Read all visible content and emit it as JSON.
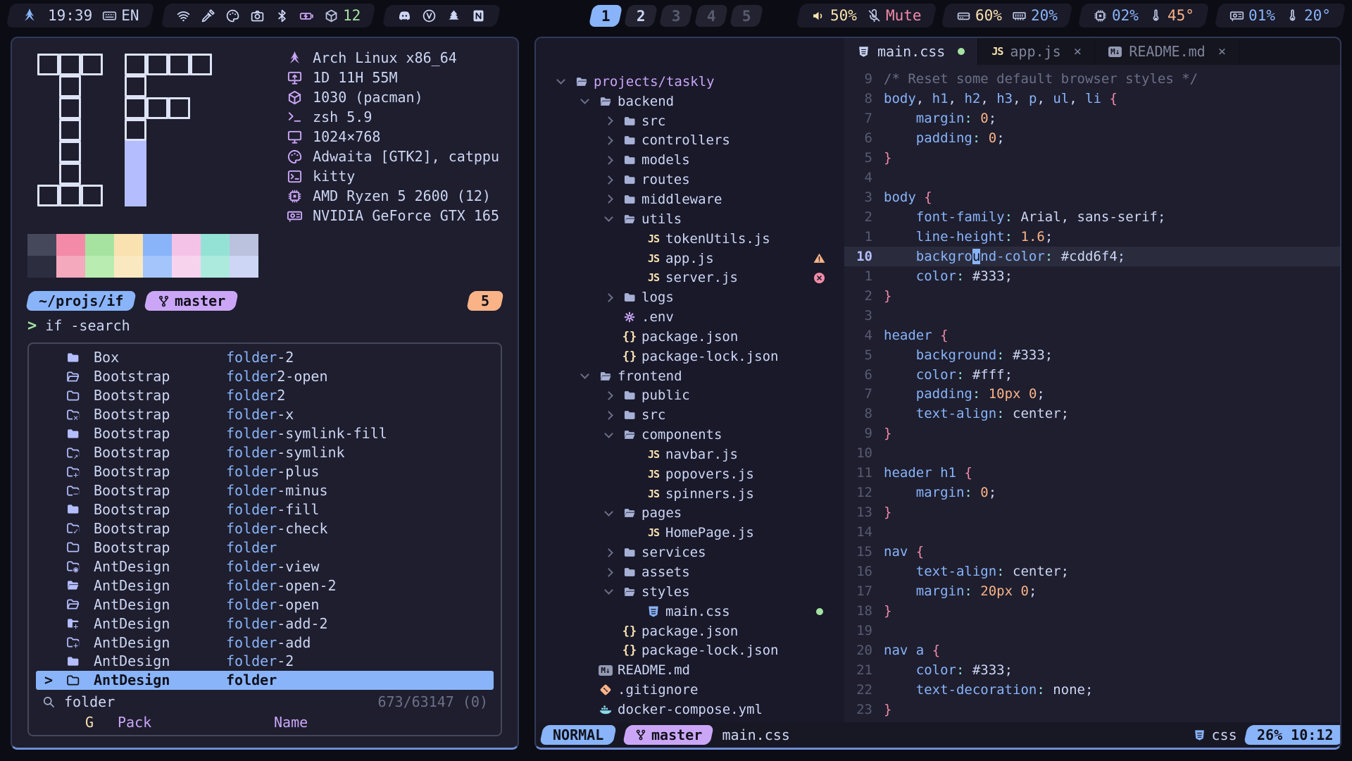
{
  "topbar": {
    "time": "19:39",
    "layout": "EN",
    "packages": "12",
    "workspaces": [
      {
        "label": "1",
        "state": "active"
      },
      {
        "label": "2",
        "state": "occupied"
      },
      {
        "label": "3",
        "state": "empty"
      },
      {
        "label": "4",
        "state": "empty"
      },
      {
        "label": "5",
        "state": "empty"
      }
    ],
    "volume": "50%",
    "mute": "Mute",
    "disk": "60%",
    "memory": "20%",
    "cpu": "02%",
    "cpu_temp": "45°",
    "gpu": "01%",
    "gpu_temp": "20°"
  },
  "terminal": {
    "fetch": {
      "logo_rows": [
        "ooo.oooo",
        ".o..o...",
        ".o..ooo.",
        ".o..o...",
        ".o..f...",
        ".o..f...",
        "ooo.f..."
      ],
      "lines": [
        {
          "icon": "arch",
          "text": "Arch Linux x86_64"
        },
        {
          "icon": "uptime",
          "text": "1D 11H 55M"
        },
        {
          "icon": "cube",
          "text": "1030 (pacman)"
        },
        {
          "icon": "shell",
          "text": "zsh 5.9"
        },
        {
          "icon": "display",
          "text": "1024×768"
        },
        {
          "icon": "palette",
          "text": "Adwaita [GTK2], catppu"
        },
        {
          "icon": "terminal",
          "text": "kitty"
        },
        {
          "icon": "cpu-chip",
          "text": "AMD Ryzen 5 2600 (12)"
        },
        {
          "icon": "gpu-card",
          "text": "NVIDIA GeForce GTX 165"
        }
      ]
    },
    "palette": {
      "row1": [
        "#45475a",
        "#f38ba8",
        "#a6e3a1",
        "#f9e2af",
        "#89b4fa",
        "#f5c2e7",
        "#94e2d5",
        "#bac2de"
      ],
      "row2": [
        "#2c2e40",
        "#f5a9bc",
        "#b8ecb0",
        "#fae9c0",
        "#a3c5fb",
        "#f8d3ee",
        "#aceade",
        "#cdd6f4"
      ]
    },
    "prompt": {
      "path": "~/projs/if",
      "branch": "master",
      "jobs": "5"
    },
    "command": "if -search",
    "finder": {
      "rows": [
        {
          "pack": "Box",
          "match": "folder",
          "rest": "-2",
          "icon": "folder-filled",
          "fico": "fill",
          "ov": ""
        },
        {
          "pack": "Bootstrap",
          "match": "folder",
          "rest": "2-open",
          "icon": "folder-open",
          "fico": "open",
          "ov": ""
        },
        {
          "pack": "Bootstrap",
          "match": "folder",
          "rest": "2",
          "icon": "folder",
          "fico": "outline",
          "ov": ""
        },
        {
          "pack": "Bootstrap",
          "match": "folder",
          "rest": "-x",
          "icon": "folder-x",
          "fico": "outline",
          "ov": "×"
        },
        {
          "pack": "Bootstrap",
          "match": "folder",
          "rest": "-symlink-fill",
          "icon": "folder-symlink-fill",
          "fico": "fill",
          "ov": ""
        },
        {
          "pack": "Bootstrap",
          "match": "folder",
          "rest": "-symlink",
          "icon": "folder-symlink",
          "fico": "outline",
          "ov": "↗"
        },
        {
          "pack": "Bootstrap",
          "match": "folder",
          "rest": "-plus",
          "icon": "folder-plus",
          "fico": "outline",
          "ov": "+"
        },
        {
          "pack": "Bootstrap",
          "match": "folder",
          "rest": "-minus",
          "icon": "folder-minus",
          "fico": "outline",
          "ov": "−"
        },
        {
          "pack": "Bootstrap",
          "match": "folder",
          "rest": "-fill",
          "icon": "folder-fill",
          "fico": "fill",
          "ov": ""
        },
        {
          "pack": "Bootstrap",
          "match": "folder",
          "rest": "-check",
          "icon": "folder-check",
          "fico": "outline",
          "ov": "✓"
        },
        {
          "pack": "Bootstrap",
          "match": "folder",
          "rest": "",
          "icon": "folder",
          "fico": "outline",
          "ov": ""
        },
        {
          "pack": "AntDesign",
          "match": "folder",
          "rest": "-view",
          "icon": "folder-view",
          "fico": "outline",
          "ov": "◉"
        },
        {
          "pack": "AntDesign",
          "match": "folder",
          "rest": "-open-2",
          "icon": "folder-open-filled",
          "fico": "open-fill",
          "ov": ""
        },
        {
          "pack": "AntDesign",
          "match": "folder",
          "rest": "-open",
          "icon": "folder-open",
          "fico": "open",
          "ov": ""
        },
        {
          "pack": "AntDesign",
          "match": "folder",
          "rest": "-add-2",
          "icon": "folder-add-filled",
          "fico": "fill",
          "ov": "+"
        },
        {
          "pack": "AntDesign",
          "match": "folder",
          "rest": "-add",
          "icon": "folder-add",
          "fico": "outline",
          "ov": "+"
        },
        {
          "pack": "AntDesign",
          "match": "folder",
          "rest": "-2",
          "icon": "folder-2",
          "fico": "fill",
          "ov": ""
        },
        {
          "pack": "AntDesign",
          "match": "folder",
          "rest": "",
          "icon": "folder",
          "fico": "outline",
          "ov": "",
          "selected": true
        }
      ],
      "query": "folder",
      "counter": "673/63147 (0)",
      "headers": [
        "G",
        "Pack",
        "Name"
      ]
    }
  },
  "nvim": {
    "tabs": [
      {
        "label": "main.css",
        "icon": "css",
        "modified": true,
        "active": true
      },
      {
        "label": "app.js",
        "icon": "js",
        "active": false
      },
      {
        "label": "README.md",
        "icon": "md",
        "active": false
      }
    ],
    "tree": [
      {
        "d": 0,
        "chev": "open",
        "icon": "folder-open",
        "label": "projects/taskly",
        "root": true
      },
      {
        "d": 1,
        "chev": "open",
        "icon": "folder-open",
        "label": "backend"
      },
      {
        "d": 2,
        "chev": "closed",
        "icon": "folder",
        "label": "src"
      },
      {
        "d": 2,
        "chev": "closed",
        "icon": "folder",
        "label": "controllers"
      },
      {
        "d": 2,
        "chev": "closed",
        "icon": "folder",
        "label": "models"
      },
      {
        "d": 2,
        "chev": "closed",
        "icon": "folder",
        "label": "routes"
      },
      {
        "d": 2,
        "chev": "closed",
        "icon": "folder",
        "label": "middleware"
      },
      {
        "d": 2,
        "chev": "open",
        "icon": "folder-open",
        "label": "utils"
      },
      {
        "d": 3,
        "icon": "js",
        "label": "tokenUtils.js"
      },
      {
        "d": 3,
        "icon": "js",
        "label": "app.js",
        "diag": "warning"
      },
      {
        "d": 3,
        "icon": "js",
        "label": "server.js",
        "diag": "error"
      },
      {
        "d": 2,
        "chev": "closed",
        "icon": "folder",
        "label": "logs"
      },
      {
        "d": 2,
        "icon": "gear",
        "label": ".env"
      },
      {
        "d": 2,
        "icon": "json",
        "label": "package.json"
      },
      {
        "d": 2,
        "icon": "json",
        "label": "package-lock.json"
      },
      {
        "d": 1,
        "chev": "open",
        "icon": "folder-open",
        "label": "frontend"
      },
      {
        "d": 2,
        "chev": "closed",
        "icon": "folder",
        "label": "public"
      },
      {
        "d": 2,
        "chev": "closed",
        "icon": "folder",
        "label": "src"
      },
      {
        "d": 2,
        "chev": "open",
        "icon": "folder-open",
        "label": "components"
      },
      {
        "d": 3,
        "icon": "js",
        "label": "navbar.js"
      },
      {
        "d": 3,
        "icon": "js",
        "label": "popovers.js"
      },
      {
        "d": 3,
        "icon": "js",
        "label": "spinners.js"
      },
      {
        "d": 2,
        "chev": "open",
        "icon": "folder-open",
        "label": "pages"
      },
      {
        "d": 3,
        "icon": "js",
        "label": "HomePage.js"
      },
      {
        "d": 2,
        "chev": "closed",
        "icon": "folder",
        "label": "services"
      },
      {
        "d": 2,
        "chev": "closed",
        "icon": "folder",
        "label": "assets"
      },
      {
        "d": 2,
        "chev": "open",
        "icon": "folder-open",
        "label": "styles"
      },
      {
        "d": 3,
        "icon": "css",
        "label": "main.css",
        "diag": "modified"
      },
      {
        "d": 2,
        "icon": "json",
        "label": "package.json"
      },
      {
        "d": 2,
        "icon": "json",
        "label": "package-lock.json"
      },
      {
        "d": 1,
        "icon": "md",
        "label": "README.md"
      },
      {
        "d": 1,
        "icon": "git",
        "label": ".gitignore"
      },
      {
        "d": 1,
        "icon": "docker",
        "label": "docker-compose.yml"
      }
    ],
    "editor_lines": [
      {
        "n": "9",
        "t": [
          [
            "cm",
            "/* Reset some default browser styles */"
          ]
        ]
      },
      {
        "n": "8",
        "t": [
          [
            "bl",
            "body"
          ],
          [
            "wh",
            ", "
          ],
          [
            "bl",
            "h1"
          ],
          [
            "wh",
            ", "
          ],
          [
            "bl",
            "h2"
          ],
          [
            "wh",
            ", "
          ],
          [
            "bl",
            "h3"
          ],
          [
            "wh",
            ", "
          ],
          [
            "bl",
            "p"
          ],
          [
            "wh",
            ", "
          ],
          [
            "bl",
            "ul"
          ],
          [
            "wh",
            ", "
          ],
          [
            "bl",
            "li"
          ],
          [
            "wh",
            " "
          ],
          [
            "pk",
            "{"
          ]
        ]
      },
      {
        "n": "7",
        "t": [
          [
            "ind",
            ""
          ],
          [
            "bl",
            "margin"
          ],
          [
            "tl",
            ":"
          ],
          [
            "wh",
            " "
          ],
          [
            "pe",
            "0"
          ],
          [
            "wh",
            ";"
          ]
        ]
      },
      {
        "n": "6",
        "t": [
          [
            "ind",
            ""
          ],
          [
            "bl",
            "padding"
          ],
          [
            "tl",
            ":"
          ],
          [
            "wh",
            " "
          ],
          [
            "pe",
            "0"
          ],
          [
            "wh",
            ";"
          ]
        ]
      },
      {
        "n": "5",
        "t": [
          [
            "pk",
            "}"
          ]
        ]
      },
      {
        "n": "4",
        "t": []
      },
      {
        "n": "3",
        "t": [
          [
            "bl",
            "body"
          ],
          [
            "wh",
            " "
          ],
          [
            "pk",
            "{"
          ]
        ]
      },
      {
        "n": "2",
        "t": [
          [
            "ind",
            ""
          ],
          [
            "bl",
            "font-family"
          ],
          [
            "tl",
            ":"
          ],
          [
            "wh",
            " Arial, sans-serif;"
          ]
        ]
      },
      {
        "n": "1",
        "t": [
          [
            "ind",
            ""
          ],
          [
            "bl",
            "line-height"
          ],
          [
            "tl",
            ":"
          ],
          [
            "wh",
            " "
          ],
          [
            "pe",
            "1.6"
          ],
          [
            "wh",
            ";"
          ]
        ]
      },
      {
        "n": "10",
        "cur": true,
        "t": [
          [
            "ind",
            ""
          ],
          [
            "bl",
            "backgro"
          ],
          [
            "cs",
            "u"
          ],
          [
            "bl",
            "nd-color"
          ],
          [
            "tl",
            ":"
          ],
          [
            "wh",
            " #cdd6f4;"
          ]
        ]
      },
      {
        "n": "1",
        "t": [
          [
            "ind",
            ""
          ],
          [
            "bl",
            "color"
          ],
          [
            "tl",
            ":"
          ],
          [
            "wh",
            " #333;"
          ]
        ]
      },
      {
        "n": "2",
        "t": [
          [
            "pk",
            "}"
          ]
        ]
      },
      {
        "n": "3",
        "t": []
      },
      {
        "n": "4",
        "t": [
          [
            "bl",
            "header"
          ],
          [
            "wh",
            " "
          ],
          [
            "pk",
            "{"
          ]
        ]
      },
      {
        "n": "5",
        "t": [
          [
            "ind",
            ""
          ],
          [
            "bl",
            "background"
          ],
          [
            "tl",
            ":"
          ],
          [
            "wh",
            " #333;"
          ]
        ]
      },
      {
        "n": "6",
        "t": [
          [
            "ind",
            ""
          ],
          [
            "bl",
            "color"
          ],
          [
            "tl",
            ":"
          ],
          [
            "wh",
            " #fff;"
          ]
        ]
      },
      {
        "n": "7",
        "t": [
          [
            "ind",
            ""
          ],
          [
            "bl",
            "padding"
          ],
          [
            "tl",
            ":"
          ],
          [
            "wh",
            " "
          ],
          [
            "pe",
            "10px"
          ],
          [
            "wh",
            " "
          ],
          [
            "pe",
            "0"
          ],
          [
            "wh",
            ";"
          ]
        ]
      },
      {
        "n": "8",
        "t": [
          [
            "ind",
            ""
          ],
          [
            "bl",
            "text-align"
          ],
          [
            "tl",
            ":"
          ],
          [
            "wh",
            " center;"
          ]
        ]
      },
      {
        "n": "9",
        "t": [
          [
            "pk",
            "}"
          ]
        ]
      },
      {
        "n": "10",
        "t": []
      },
      {
        "n": "11",
        "t": [
          [
            "bl",
            "header"
          ],
          [
            "wh",
            " "
          ],
          [
            "bl",
            "h1"
          ],
          [
            "wh",
            " "
          ],
          [
            "pk",
            "{"
          ]
        ]
      },
      {
        "n": "12",
        "t": [
          [
            "ind",
            ""
          ],
          [
            "bl",
            "margin"
          ],
          [
            "tl",
            ":"
          ],
          [
            "wh",
            " "
          ],
          [
            "pe",
            "0"
          ],
          [
            "wh",
            ";"
          ]
        ]
      },
      {
        "n": "13",
        "t": [
          [
            "pk",
            "}"
          ]
        ]
      },
      {
        "n": "14",
        "t": []
      },
      {
        "n": "15",
        "t": [
          [
            "bl",
            "nav"
          ],
          [
            "wh",
            " "
          ],
          [
            "pk",
            "{"
          ]
        ]
      },
      {
        "n": "16",
        "t": [
          [
            "ind",
            ""
          ],
          [
            "bl",
            "text-align"
          ],
          [
            "tl",
            ":"
          ],
          [
            "wh",
            " center;"
          ]
        ]
      },
      {
        "n": "17",
        "t": [
          [
            "ind",
            ""
          ],
          [
            "bl",
            "margin"
          ],
          [
            "tl",
            ":"
          ],
          [
            "wh",
            " "
          ],
          [
            "pe",
            "20px"
          ],
          [
            "wh",
            " "
          ],
          [
            "pe",
            "0"
          ],
          [
            "wh",
            ";"
          ]
        ]
      },
      {
        "n": "18",
        "t": [
          [
            "pk",
            "}"
          ]
        ]
      },
      {
        "n": "19",
        "t": []
      },
      {
        "n": "20",
        "t": [
          [
            "bl",
            "nav"
          ],
          [
            "wh",
            " "
          ],
          [
            "bl",
            "a"
          ],
          [
            "wh",
            " "
          ],
          [
            "pk",
            "{"
          ]
        ]
      },
      {
        "n": "21",
        "t": [
          [
            "ind",
            ""
          ],
          [
            "bl",
            "color"
          ],
          [
            "tl",
            ":"
          ],
          [
            "wh",
            " #333;"
          ]
        ]
      },
      {
        "n": "22",
        "t": [
          [
            "ind",
            ""
          ],
          [
            "bl",
            "text-decoration"
          ],
          [
            "tl",
            ":"
          ],
          [
            "wh",
            " none;"
          ]
        ]
      },
      {
        "n": "23",
        "t": [
          [
            "pk",
            "}"
          ]
        ]
      }
    ],
    "statusline": {
      "mode": "NORMAL",
      "branch": "master",
      "file": "main.css",
      "filetype": "css",
      "position": "26% 10:12"
    }
  }
}
